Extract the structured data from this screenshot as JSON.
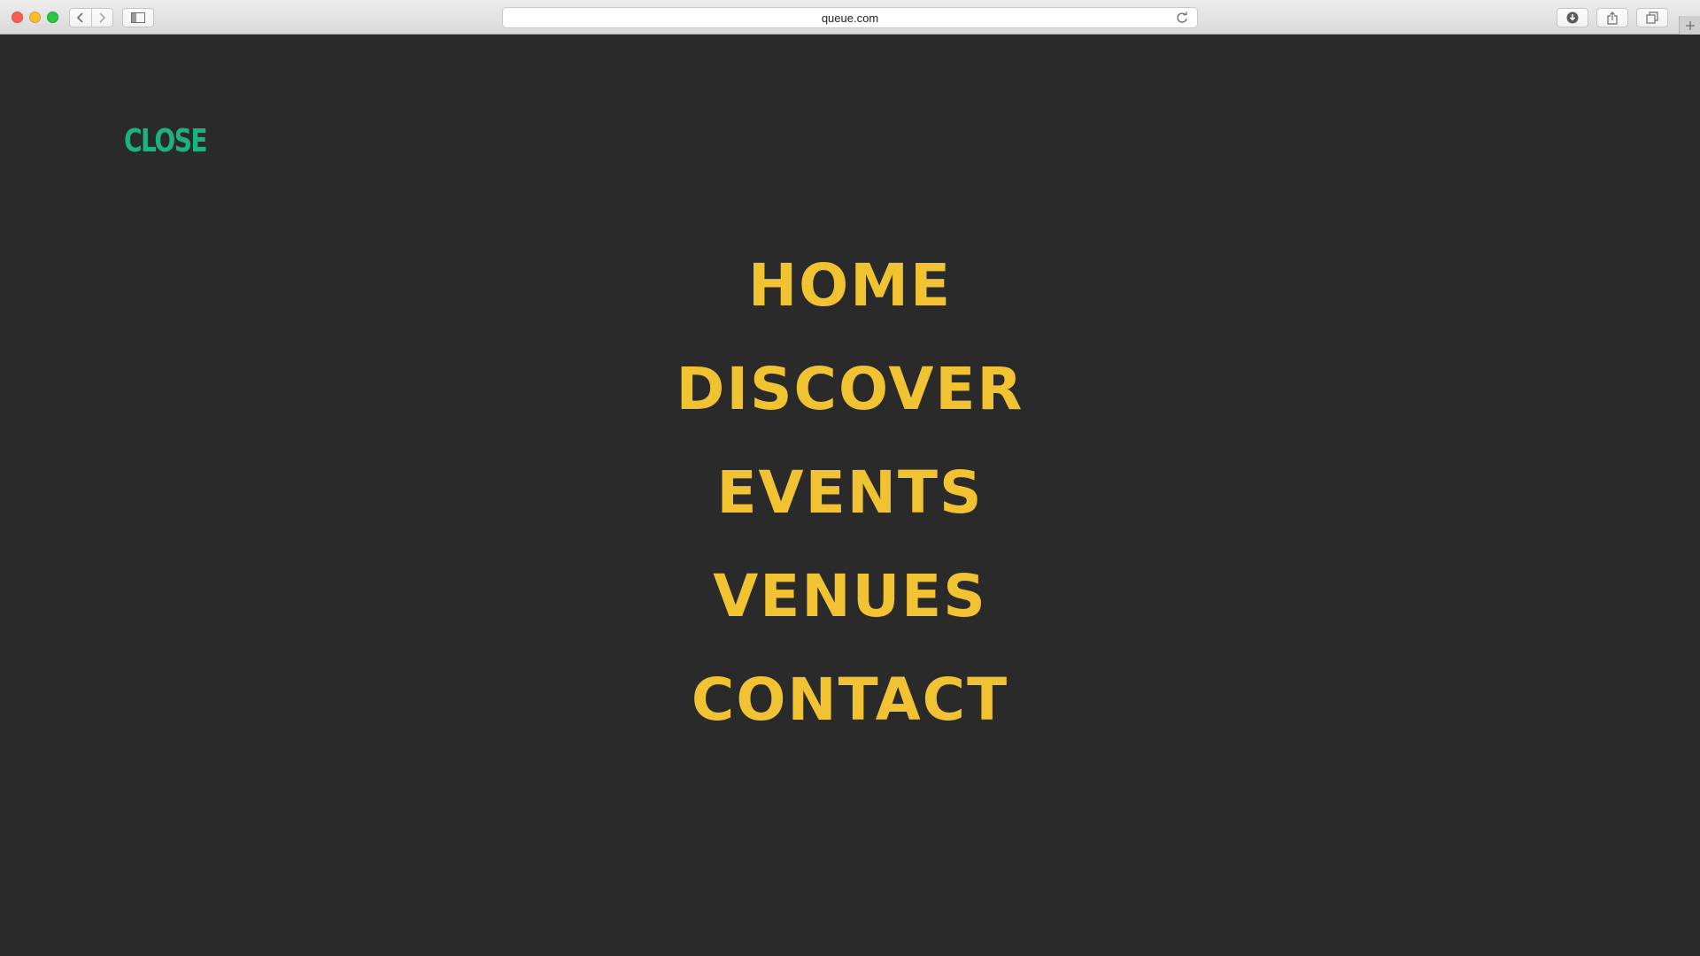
{
  "browser": {
    "url": "queue.com",
    "icons": [
      "back-arrow-icon",
      "forward-arrow-icon",
      "sidebar-icon",
      "reload-icon",
      "download-icon",
      "share-icon",
      "tabs-icon",
      "plus-icon"
    ]
  },
  "colors": {
    "background": "#2a2a2a",
    "close_accent": "#1db27e",
    "menu_text": "#f1c232"
  },
  "overlay": {
    "close_label": "CLOSE",
    "menu": [
      {
        "label": "HOME"
      },
      {
        "label": "DISCOVER"
      },
      {
        "label": "EVENTS"
      },
      {
        "label": "VENUES"
      },
      {
        "label": "CONTACT"
      }
    ]
  }
}
